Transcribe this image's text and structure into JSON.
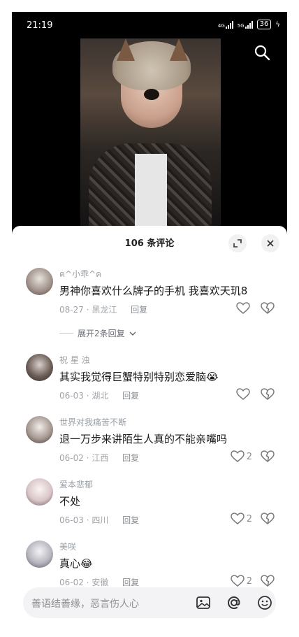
{
  "status_bar": {
    "time": "21:19",
    "signal_1": "4G",
    "signal_2": "5G",
    "battery": "36"
  },
  "comments_panel": {
    "title": "106 条评论",
    "comments": [
      {
        "username": "ค^小乖^ค",
        "text": "男神你喜欢什么牌子的手机 我喜欢天玑8",
        "date": "08-27",
        "location": "黑龙江",
        "reply_label": "回复",
        "likes": "",
        "expand_label": "展开2条回复"
      },
      {
        "username": "祝 星 浊",
        "text": "其实我觉得巨蟹特别特别恋爱脑😭",
        "date": "06-03",
        "location": "湖北",
        "reply_label": "回复",
        "likes": ""
      },
      {
        "username": "世界对我痛苦不断",
        "text": "退一万步来讲陌生人真的不能亲嘴吗",
        "date": "06-02",
        "location": "江西",
        "reply_label": "回复",
        "likes": "2"
      },
      {
        "username": "爱本悲郁",
        "text": "不处",
        "date": "06-03",
        "location": "四川",
        "reply_label": "回复",
        "likes": "2"
      },
      {
        "username": "美咲",
        "text": "真心😂",
        "date": "06-02",
        "location": "安徽",
        "reply_label": "回复",
        "likes": "2"
      }
    ],
    "input_placeholder": "善语结善缘，恶言伤人心"
  }
}
